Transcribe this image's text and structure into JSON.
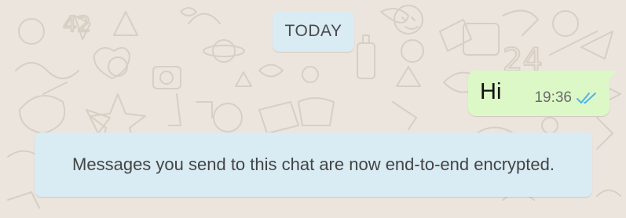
{
  "conversation": {
    "date_label": "TODAY",
    "messages": [
      {
        "direction": "outgoing",
        "text": "Hi",
        "time": "19:36",
        "status_icon": "double-check-read-icon",
        "read_color": "#4fb3e8"
      }
    ],
    "system_notice": "Messages you send to this chat are now end-to-end encrypted."
  },
  "colors": {
    "wallpaper": "#ece5dd",
    "outgoing_bubble": "#dcf8c6",
    "system_bubble": "#d9ebf3",
    "doodle_stroke": "#d8d1c7"
  }
}
